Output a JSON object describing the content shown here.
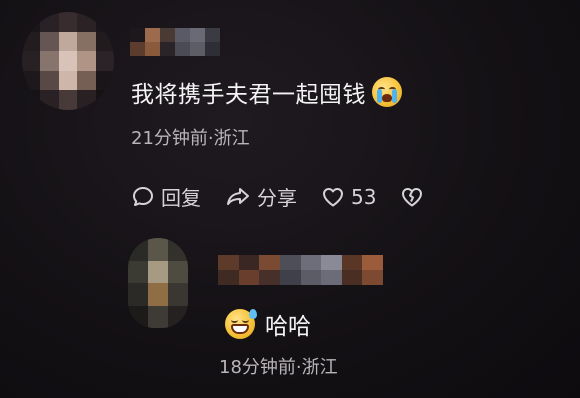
{
  "comment": {
    "text": "我将携手夫君一起囤钱",
    "emoji": "loudly-crying-face",
    "meta": "21分钟前·浙江",
    "actions": {
      "reply_label": "回复",
      "share_label": "分享",
      "like_count": "53"
    }
  },
  "reply": {
    "text": "哈哈",
    "emoji": "grinning-face-with-sweat",
    "meta": "18分钟前·浙江"
  },
  "colors": {
    "background": "#141115",
    "text_primary": "#f2f2f2",
    "text_secondary": "#b8b4b8",
    "icon": "#d6d3d6"
  }
}
